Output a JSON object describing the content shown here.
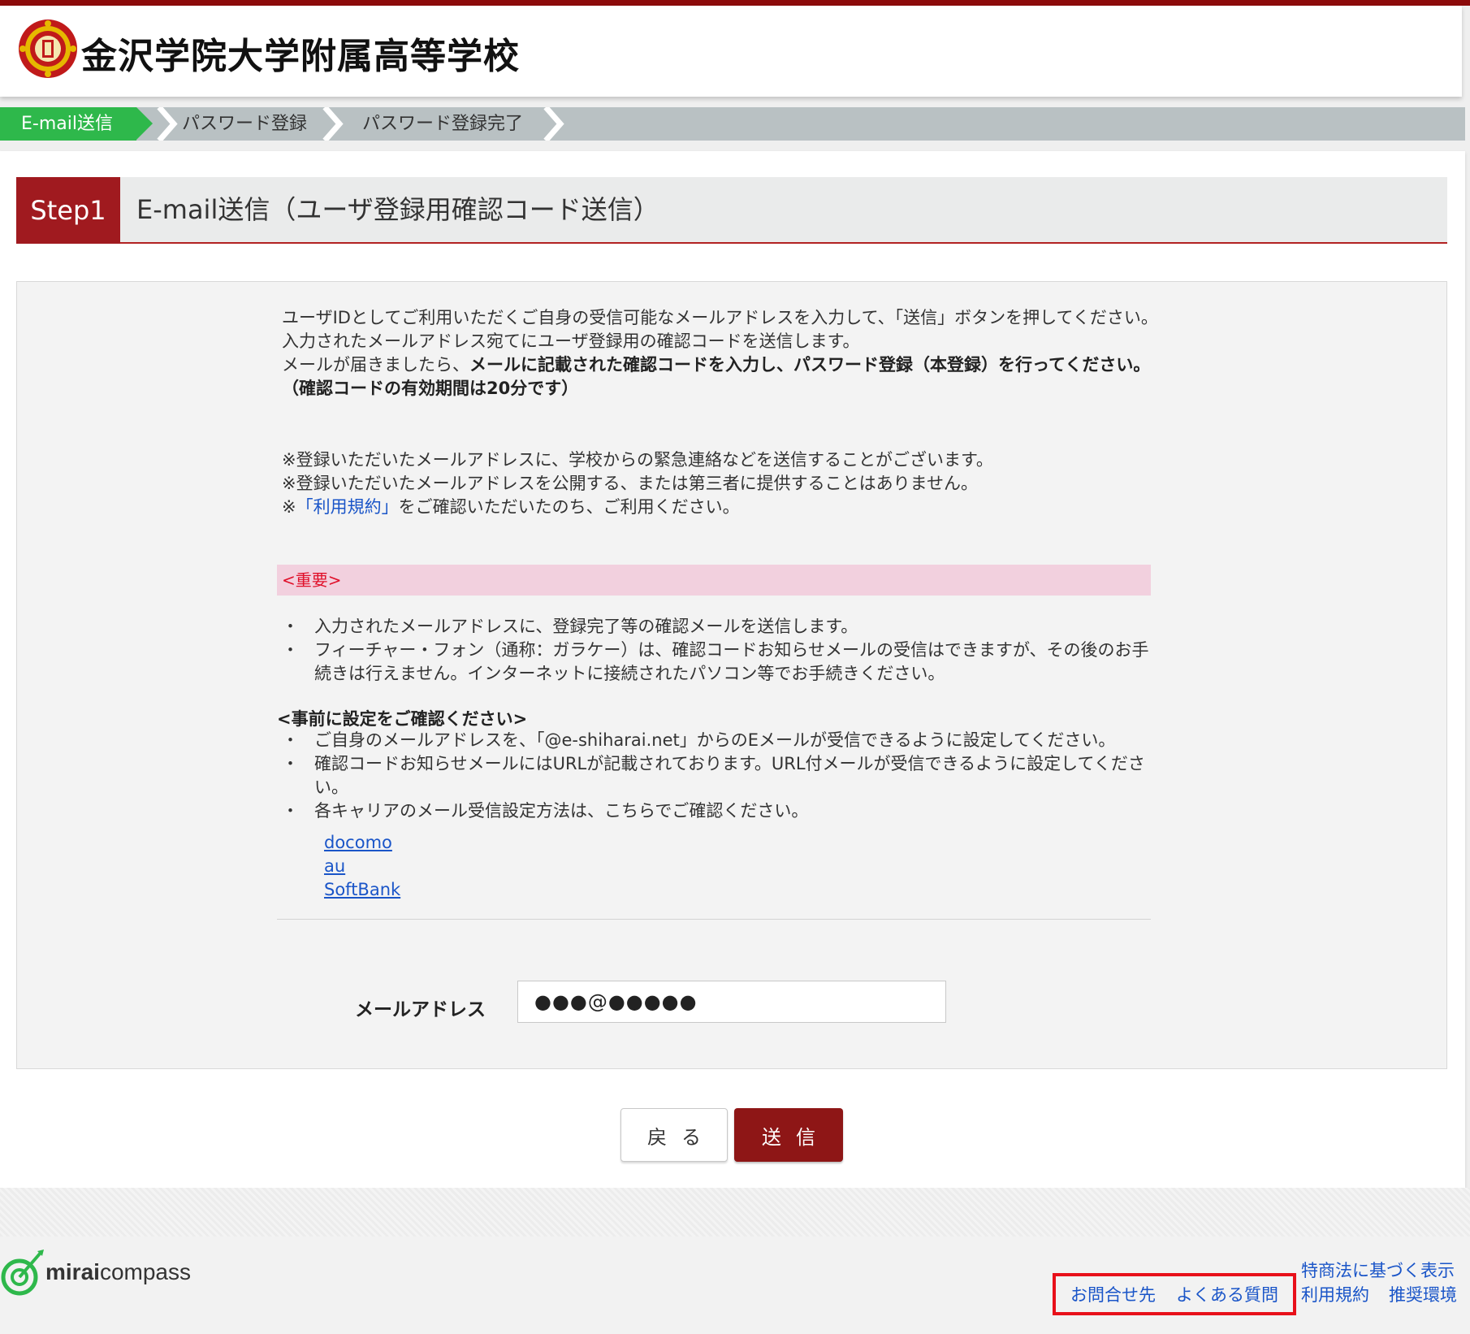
{
  "header": {
    "school_name": "金沢学院大学附属高等学校"
  },
  "progress": {
    "steps": [
      "E-mail送信",
      "パスワード登録",
      "パスワード登録完了"
    ],
    "active_index": 0
  },
  "step": {
    "badge": "Step1",
    "title": "E-mail送信（ユーザ登録用確認コード送信）"
  },
  "intro": {
    "line1": "ユーザIDとしてご利用いただくご自身の受信可能なメールアドレスを入力して、「送信」ボタンを押してください。",
    "line2": "入力されたメールアドレス宛てにユーザ登録用の確認コードを送信します。",
    "line3_plain": "メールが届きましたら、",
    "line3_bold": "メールに記載された確認コードを入力し、パスワード登録（本登録）を行ってください。",
    "line4_bold": "（確認コードの有効期間は20分です）"
  },
  "notes": {
    "note1": "※登録いただいたメールアドレスに、学校からの緊急連絡などを送信することがございます。",
    "note2": "※登録いただいたメールアドレスを公開する、または第三者に提供することはありません。",
    "note3_prefix": "※",
    "note3_link": "「利用規約」",
    "note3_suffix": "をご確認いただいたのち、ご利用ください。"
  },
  "important": {
    "label": "<重要>",
    "bullet_mark": "・",
    "items": [
      "入力されたメールアドレスに、登録完了等の確認メールを送信します。",
      "フィーチャー・フォン（通称：ガラケー）は、確認コードお知らせメールの受信はできますが、その後のお手続きは行えません。インターネットに接続されたパソコン等でお手続きください。"
    ]
  },
  "pre_check": {
    "title": "<事前に設定をご確認ください>",
    "items": [
      "ご自身のメールアドレスを、「@e-shiharai.net」からのEメールが受信できるように設定してください。",
      "確認コードお知らせメールにはURLが記載されております。URL付メールが受信できるように設定してください。",
      "各キャリアのメール受信設定方法は、こちらでご確認ください。"
    ],
    "carriers": [
      "docomo",
      "au",
      "SoftBank"
    ]
  },
  "form": {
    "email_label": "メールアドレス",
    "email_value": "●●●@●●●●●"
  },
  "buttons": {
    "back": "戻る",
    "send": "送信"
  },
  "footer": {
    "logo_bold": "mirai",
    "logo_rest": "compass",
    "links": {
      "contact": "お問合せ先",
      "faq": "よくある質問",
      "tokushoho": "特商法に基づく表示",
      "terms": "利用規約",
      "env": "推奨環境"
    }
  },
  "colors": {
    "brand_red": "#8e1616",
    "progress_active": "#2eb84b",
    "link": "#1a55c8",
    "important_bg": "#f2d0de",
    "highlight": "#e8101a"
  }
}
